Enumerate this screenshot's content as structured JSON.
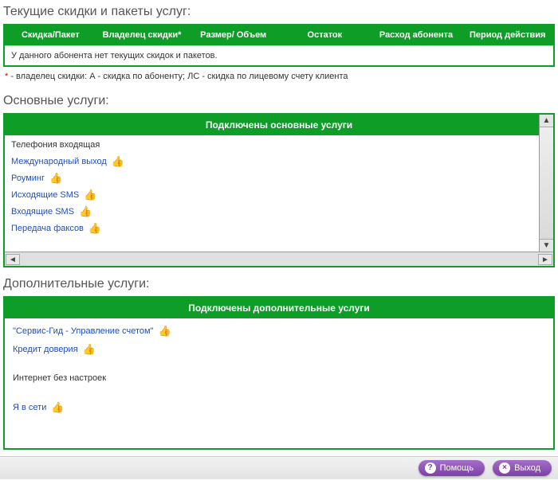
{
  "discounts": {
    "title": "Текущие скидки и пакеты услуг:",
    "headers": {
      "c1": "Скидка/Пакет",
      "c2": "Владелец скидки*",
      "c3": "Размер/ Объем",
      "c4": "Остаток",
      "c5": "Расход абонента",
      "c6": "Период действия"
    },
    "empty_row": "У данного абонента нет текущих скидок и пакетов.",
    "footnote_star": "*",
    "footnote_text": " - владелец скидки: А - скидка по абоненту; ЛС - скидка по лицевому счету клиента"
  },
  "main_services": {
    "title": "Основные услуги:",
    "header": "Подключены основные услуги",
    "items": [
      {
        "label": "Телефония входящая",
        "link": false,
        "thumb": false
      },
      {
        "label": "Международный выход",
        "link": true,
        "thumb": true
      },
      {
        "label": "Роуминг",
        "link": true,
        "thumb": true
      },
      {
        "label": "Исходящие SMS",
        "link": true,
        "thumb": true
      },
      {
        "label": "Входящие SMS",
        "link": true,
        "thumb": true
      },
      {
        "label": "Передача факсов",
        "link": true,
        "thumb": true
      }
    ]
  },
  "addl_services": {
    "title": "Дополнительные услуги:",
    "header": "Подключены дополнительные услуги",
    "items": [
      {
        "label": "\"Сервис-Гид - Управление счетом\"",
        "link": true,
        "thumb": true
      },
      {
        "label": "Кредит доверия",
        "link": true,
        "thumb": true
      },
      {
        "label": "",
        "link": false,
        "thumb": false
      },
      {
        "label": "Интернет без настроек",
        "link": false,
        "thumb": false
      },
      {
        "label": "",
        "link": false,
        "thumb": false
      },
      {
        "label": "Я в сети",
        "link": true,
        "thumb": true
      }
    ]
  },
  "footer": {
    "help": "Помощь",
    "exit": "Выход"
  },
  "icons": {
    "thumb": "👍",
    "qmark": "?",
    "xmark": "×",
    "tri_up": "▲",
    "tri_down": "▼",
    "tri_left": "◄",
    "tri_right": "►"
  }
}
